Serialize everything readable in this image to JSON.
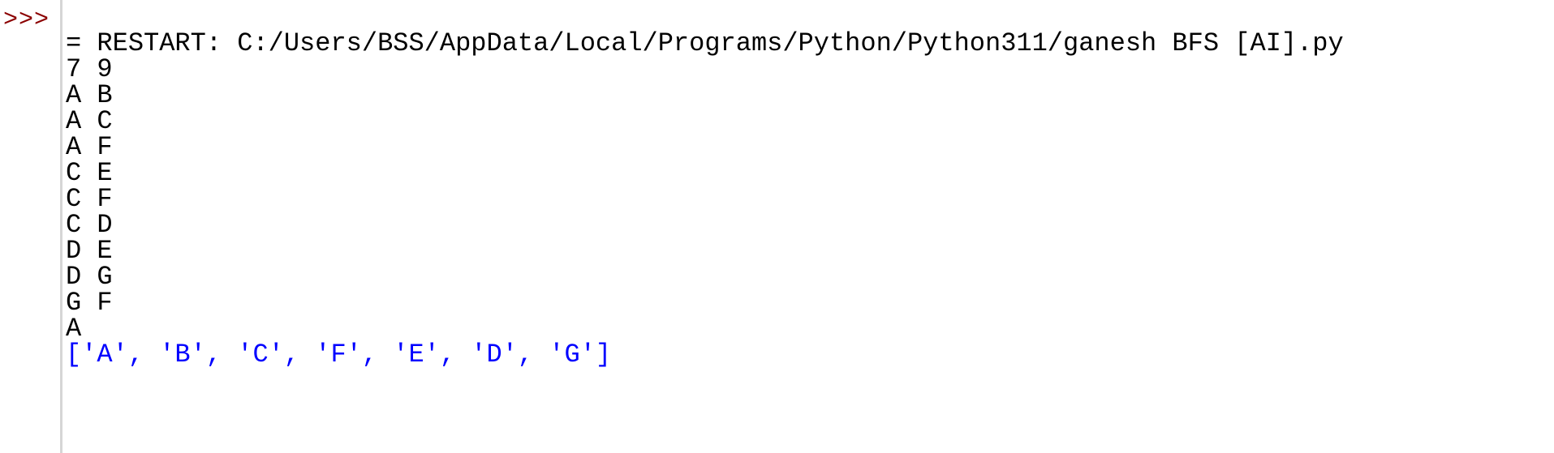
{
  "prompt": ">>>",
  "partial_line": "app_snapshot_clipped_line",
  "restart_line": "= RESTART: C:/Users/BSS/AppData/Local/Programs/Python/Python311/ganesh BFS [AI].py",
  "input_lines": [
    "7 9",
    "A B",
    "A C",
    "A F",
    "C E",
    "C F",
    "C D",
    "D E",
    "D G",
    "G F",
    "A"
  ],
  "result_line": "['A', 'B', 'C', 'F', 'E', 'D', 'G']",
  "colors": {
    "prompt": "#8b0000",
    "output": "#000000",
    "result": "#0000ff",
    "gutter_divider": "#d6d6d6",
    "background": "#ffffff"
  }
}
